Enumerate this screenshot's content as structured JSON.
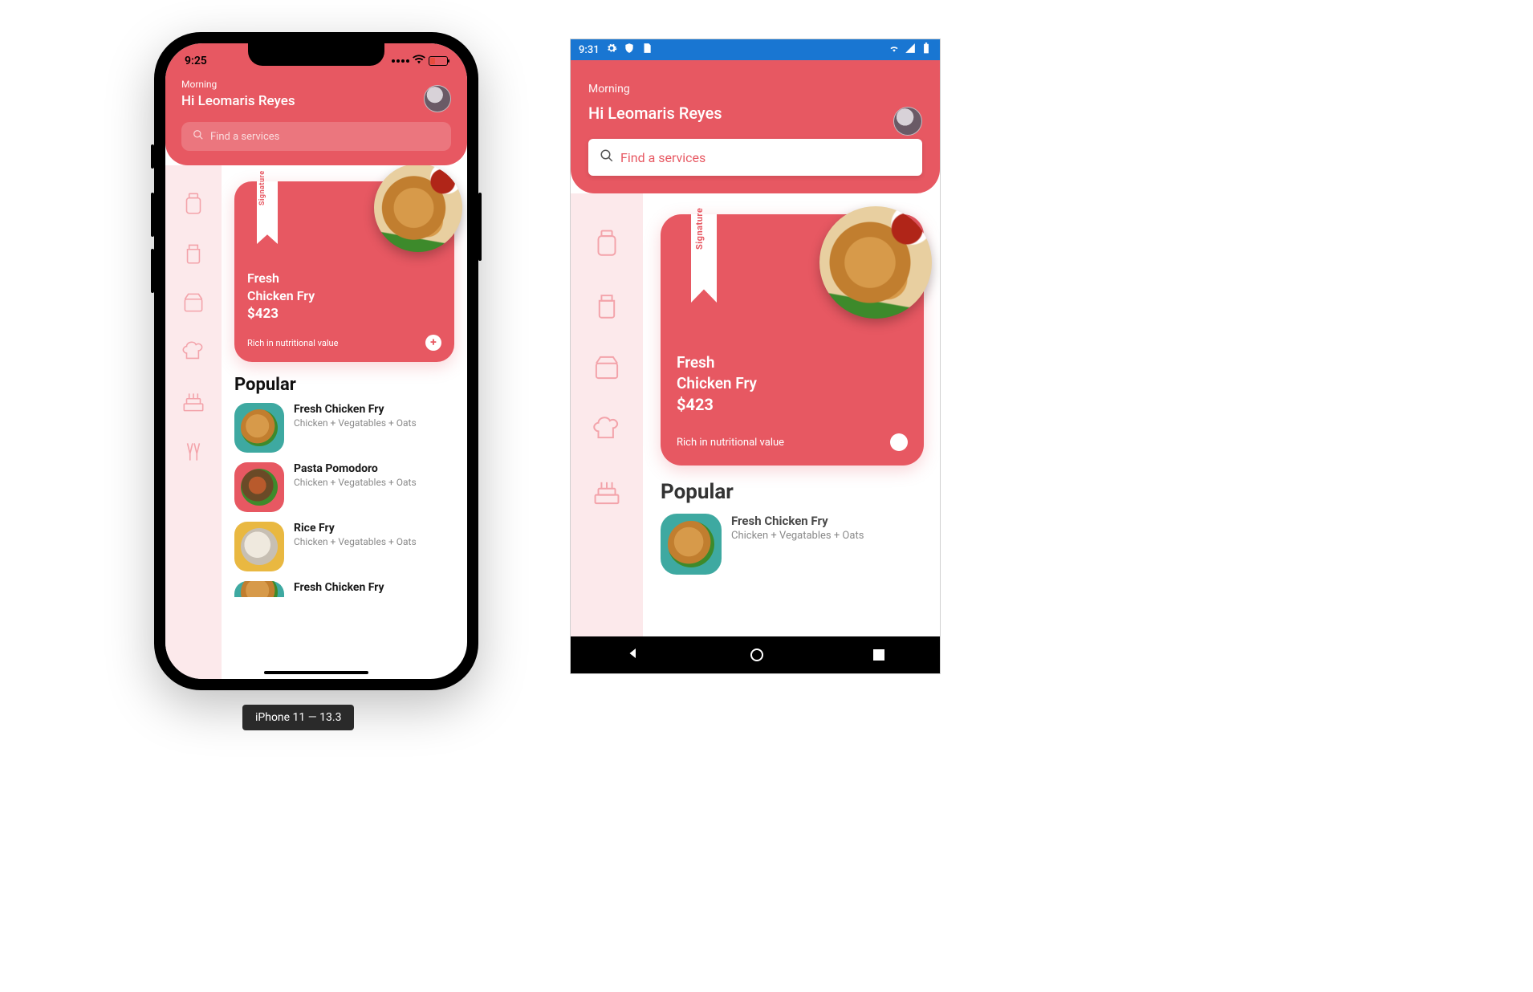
{
  "ios": {
    "status": {
      "time": "9:25"
    },
    "header": {
      "greeting_small": "Morning",
      "greeting_main": "Hi Leomaris Reyes",
      "search_placeholder": "Find a services"
    },
    "feature": {
      "ribbon": "Signature",
      "title_line1": "Fresh",
      "title_line2": "Chicken Fry",
      "price": "$423",
      "subtitle": "Rich in nutritional value"
    },
    "popular_heading": "Popular",
    "popular": [
      {
        "title": "Fresh Chicken Fry",
        "sub": "Chicken + Vegatables + Oats",
        "color": "teal"
      },
      {
        "title": "Pasta Pomodoro",
        "sub": "Chicken + Vegatables + Oats",
        "color": "red"
      },
      {
        "title": "Rice Fry",
        "sub": "Chicken + Vegatables + Oats",
        "color": "yellow"
      },
      {
        "title": "Fresh Chicken Fry",
        "sub": "",
        "color": "teal"
      }
    ],
    "device_label": "iPhone 11 — 13.3"
  },
  "android": {
    "status": {
      "time": "9:31"
    },
    "header": {
      "greeting_small": "Morning",
      "greeting_main": "Hi Leomaris Reyes",
      "search_placeholder": "Find a services"
    },
    "feature": {
      "ribbon": "Signature",
      "title_line1": "Fresh",
      "title_line2": "Chicken Fry",
      "price": "$423",
      "subtitle": "Rich in nutritional value"
    },
    "popular_heading": "Popular",
    "popular": [
      {
        "title": "Fresh Chicken Fry",
        "sub": "Chicken + Vegatables + Oats",
        "color": "teal"
      }
    ]
  }
}
